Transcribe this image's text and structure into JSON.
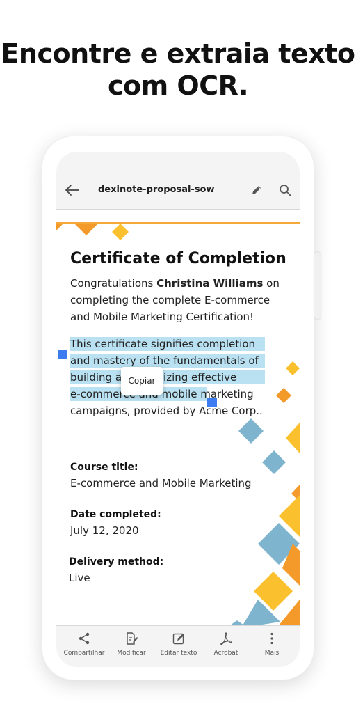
{
  "headline": {
    "line1": "Encontre e extraia texto",
    "line2": "com OCR."
  },
  "appbar": {
    "title": "dexinote-proposal-sow"
  },
  "document": {
    "heading": "Certificate of Completion",
    "congrats_prefix": "Congratulations ",
    "congrats_name": "Christina Williams",
    "congrats_suffix": " on completing the complete E-commerce and Mobile Marketing Certification!",
    "selected_lines": [
      "This certificate signifies completion",
      "and mastery of the fundamentals of",
      "building a customizing effective",
      "e-commerce and mobile marketing",
      "campaigns, provided by Acme Corp.."
    ],
    "copy_popup": "Copiar",
    "fields": [
      {
        "label": "Course title:",
        "value": "E-commerce and Mobile Marketing"
      },
      {
        "label": "Date completed:",
        "value": "July 12, 2020"
      },
      {
        "label": "Delivery method:",
        "value": "Live"
      }
    ]
  },
  "toolbar": {
    "items": [
      {
        "label": "Compartilhar",
        "icon": "share-icon"
      },
      {
        "label": "Modificar",
        "icon": "modify-icon"
      },
      {
        "label": "Editar texto",
        "icon": "edit-text-icon"
      },
      {
        "label": "Acrobat",
        "icon": "acrobat-icon"
      },
      {
        "label": "Mais",
        "icon": "more-icon"
      }
    ]
  },
  "colors": {
    "accent_orange": "#f49a2a",
    "accent_yellow": "#fbc02d",
    "accent_blue": "#7fb4cf",
    "selection": "#b9e1f2",
    "handle": "#3c7bf0"
  }
}
